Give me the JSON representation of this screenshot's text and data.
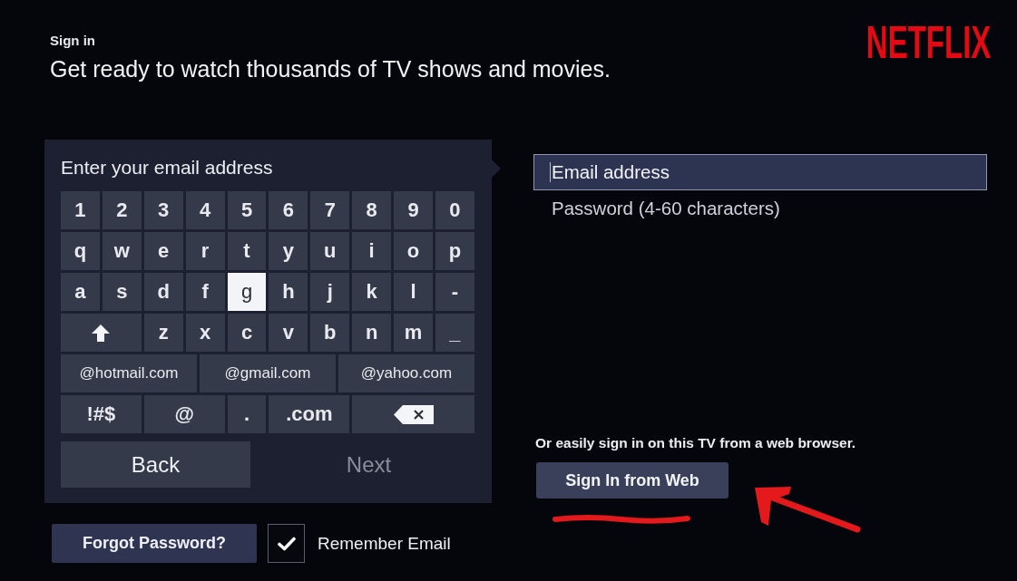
{
  "header": {
    "subtitle": "Sign in",
    "heading": "Get ready to watch thousands of TV shows and movies.",
    "logo": "NETFLIX"
  },
  "keyboard": {
    "title": "Enter your email address",
    "rows": [
      {
        "keys": [
          {
            "kind": "key",
            "label": "1",
            "selected": false
          },
          {
            "kind": "key",
            "label": "2",
            "selected": false
          },
          {
            "kind": "key",
            "label": "3",
            "selected": false
          },
          {
            "kind": "key",
            "label": "4",
            "selected": false
          },
          {
            "kind": "key",
            "label": "5",
            "selected": false
          },
          {
            "kind": "key",
            "label": "6",
            "selected": false
          },
          {
            "kind": "key",
            "label": "7",
            "selected": false
          },
          {
            "kind": "key",
            "label": "8",
            "selected": false
          },
          {
            "kind": "key",
            "label": "9",
            "selected": false
          },
          {
            "kind": "key",
            "label": "0",
            "selected": false
          }
        ]
      },
      {
        "keys": [
          {
            "kind": "key",
            "label": "q",
            "selected": false
          },
          {
            "kind": "key",
            "label": "w",
            "selected": false
          },
          {
            "kind": "key",
            "label": "e",
            "selected": false
          },
          {
            "kind": "key",
            "label": "r",
            "selected": false
          },
          {
            "kind": "key",
            "label": "t",
            "selected": false
          },
          {
            "kind": "key",
            "label": "y",
            "selected": false
          },
          {
            "kind": "key",
            "label": "u",
            "selected": false
          },
          {
            "kind": "key",
            "label": "i",
            "selected": false
          },
          {
            "kind": "key",
            "label": "o",
            "selected": false
          },
          {
            "kind": "key",
            "label": "p",
            "selected": false
          }
        ]
      },
      {
        "keys": [
          {
            "kind": "key",
            "label": "a",
            "selected": false
          },
          {
            "kind": "key",
            "label": "s",
            "selected": false
          },
          {
            "kind": "key",
            "label": "d",
            "selected": false
          },
          {
            "kind": "key",
            "label": "f",
            "selected": false
          },
          {
            "kind": "key",
            "label": "g",
            "selected": true
          },
          {
            "kind": "key",
            "label": "h",
            "selected": false
          },
          {
            "kind": "key",
            "label": "j",
            "selected": false
          },
          {
            "kind": "key",
            "label": "k",
            "selected": false
          },
          {
            "kind": "key",
            "label": "l",
            "selected": false
          },
          {
            "kind": "key",
            "label": "-",
            "selected": false
          }
        ]
      },
      {
        "keys": [
          {
            "kind": "shift",
            "selected": false
          },
          {
            "kind": "key",
            "label": "z",
            "selected": false
          },
          {
            "kind": "key",
            "label": "x",
            "selected": false
          },
          {
            "kind": "key",
            "label": "c",
            "selected": false
          },
          {
            "kind": "key",
            "label": "v",
            "selected": false
          },
          {
            "kind": "key",
            "label": "b",
            "selected": false
          },
          {
            "kind": "key",
            "label": "n",
            "selected": false
          },
          {
            "kind": "key",
            "label": "m",
            "selected": false
          },
          {
            "kind": "key",
            "label": "_",
            "selected": false
          }
        ]
      },
      {
        "keys": [
          {
            "kind": "domain",
            "label": "@hotmail.com",
            "selected": false
          },
          {
            "kind": "domain",
            "label": "@gmail.com",
            "selected": false
          },
          {
            "kind": "domain",
            "label": "@yahoo.com",
            "selected": false
          }
        ]
      },
      {
        "keys": [
          {
            "kind": "wide",
            "label": "!#$",
            "selected": false
          },
          {
            "kind": "wide",
            "label": "@",
            "selected": false
          },
          {
            "kind": "key",
            "label": ".",
            "selected": false
          },
          {
            "kind": "wide",
            "label": ".com",
            "selected": false
          },
          {
            "kind": "backspace",
            "selected": false
          }
        ]
      }
    ],
    "actions": [
      {
        "label": "Back",
        "disabled": false
      },
      {
        "label": "Next",
        "disabled": true
      }
    ]
  },
  "fields": [
    {
      "placeholder": "Email address",
      "focused": true
    },
    {
      "placeholder": "Password (4-60 characters)",
      "focused": false
    }
  ],
  "web_sign_in": {
    "text": "Or easily sign in on this TV from a web browser.",
    "button": "Sign In from Web"
  },
  "forgot_password": "Forgot Password?",
  "remember_email": {
    "label": "Remember Email",
    "checked": true
  }
}
